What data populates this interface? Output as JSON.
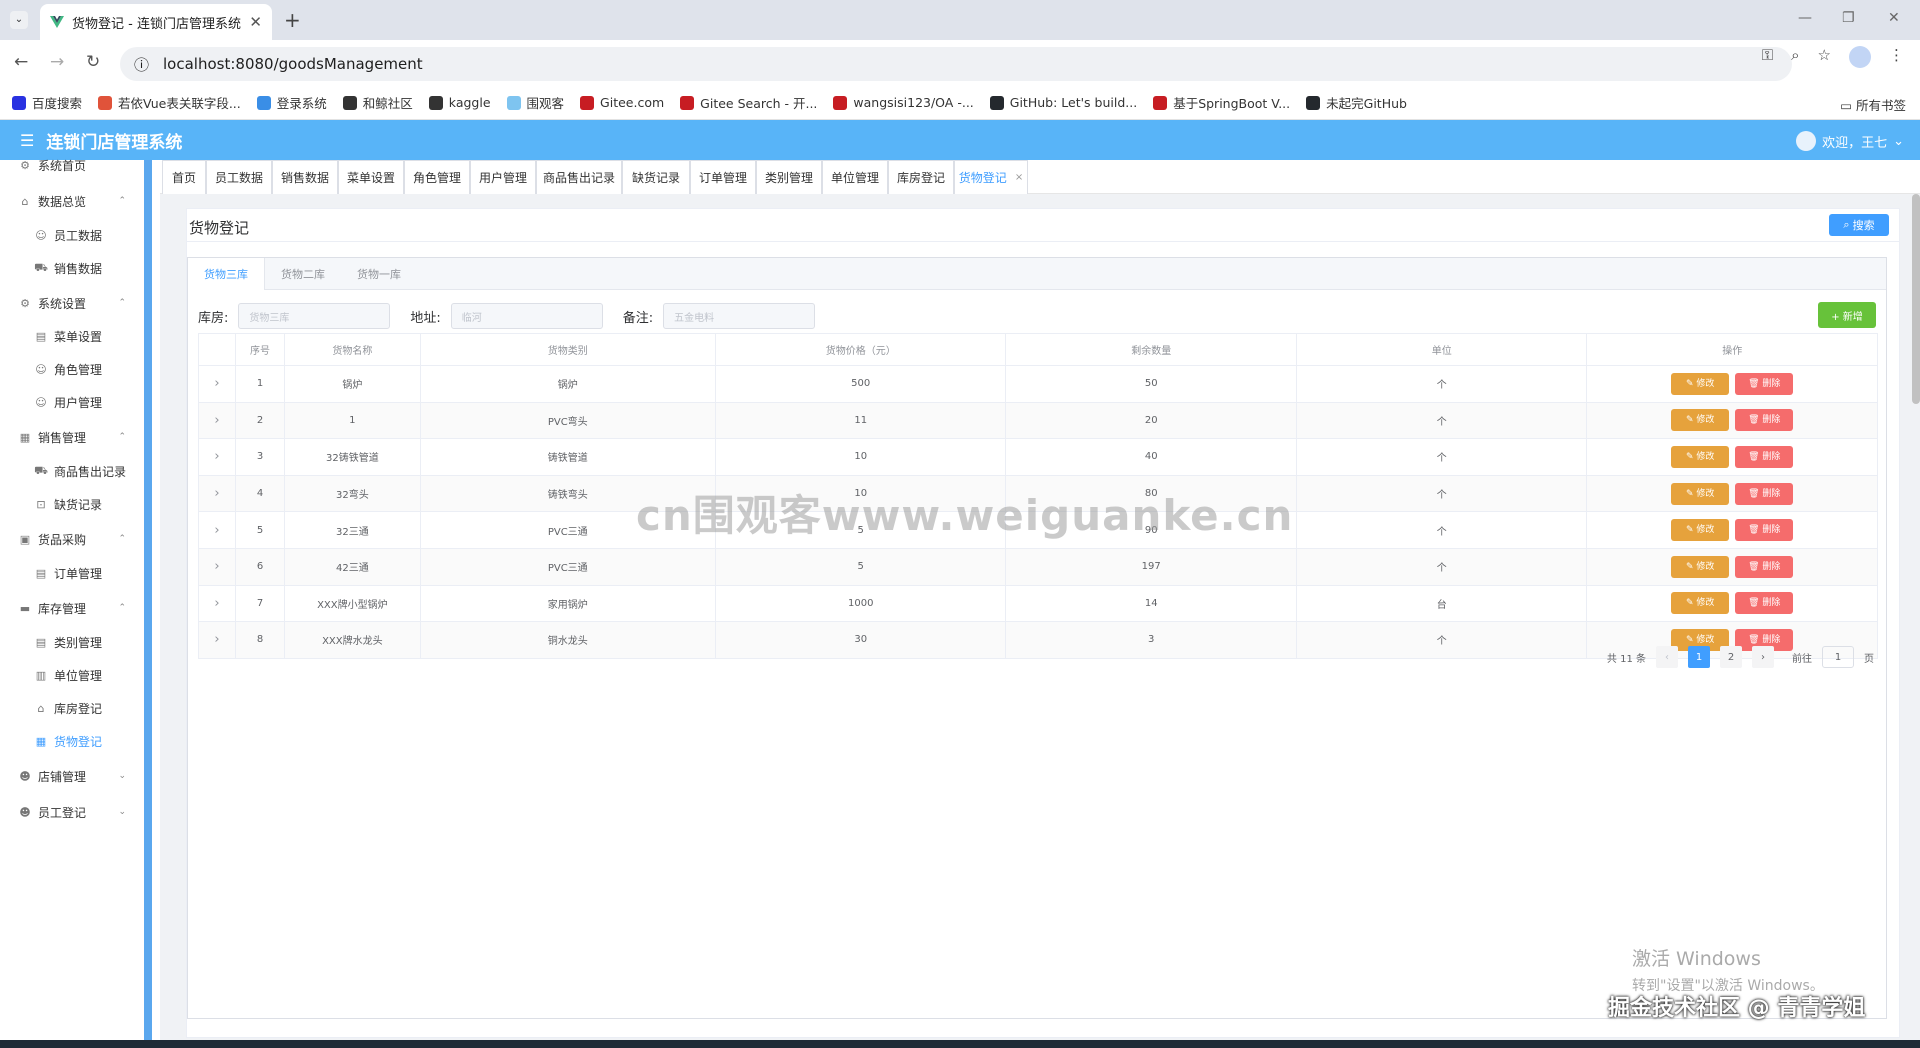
{
  "browser": {
    "tab_title": "货物登记 - 连锁门店管理系统",
    "tab_close": "✕",
    "new_tab": "+",
    "url": "localhost:8080/goodsManagement",
    "bookmarks": [
      {
        "label": "百度搜索",
        "color": "#2932e1"
      },
      {
        "label": "若依Vue表关联字段...",
        "color": "#e0533a"
      },
      {
        "label": "登录系统",
        "color": "#3a8ee6"
      },
      {
        "label": "和鲸社区",
        "color": "#333333"
      },
      {
        "label": "kaggle",
        "color": "#333333"
      },
      {
        "label": "围观客",
        "color": "#7ec4f0"
      },
      {
        "label": "Gitee.com",
        "color": "#c71d23"
      },
      {
        "label": "Gitee Search - 开...",
        "color": "#c71d23"
      },
      {
        "label": "wangsisi123/OA -...",
        "color": "#c71d23"
      },
      {
        "label": "GitHub: Let's build...",
        "color": "#24292e"
      },
      {
        "label": "基于SpringBoot V...",
        "color": "#c71d23"
      },
      {
        "label": "未起完GitHub",
        "color": "#24292e"
      }
    ],
    "all_bookmarks": "所有书签"
  },
  "app": {
    "title": "连锁门店管理系统",
    "user": "欢迎，王七",
    "accent": "#58b4f8"
  },
  "sidebar": [
    {
      "label": "系统首页",
      "level": 0,
      "icon": "gear-icon",
      "glyph": "⚙"
    },
    {
      "label": "数据总览",
      "level": 0,
      "icon": "home-icon",
      "glyph": "⌂",
      "chev": "⌃"
    },
    {
      "label": "员工数据",
      "level": 1,
      "icon": "user-icon",
      "glyph": "☺"
    },
    {
      "label": "销售数据",
      "level": 1,
      "icon": "truck-icon",
      "glyph": "⛟"
    },
    {
      "label": "系统设置",
      "level": 0,
      "icon": "settings-icon",
      "glyph": "⚙",
      "chev": "⌃"
    },
    {
      "label": "菜单设置",
      "level": 1,
      "icon": "document-icon",
      "glyph": "▤"
    },
    {
      "label": "角色管理",
      "level": 1,
      "icon": "user-icon",
      "glyph": "☺"
    },
    {
      "label": "用户管理",
      "level": 1,
      "icon": "user-icon",
      "glyph": "☺"
    },
    {
      "label": "销售管理",
      "level": 0,
      "icon": "list-icon",
      "glyph": "▦",
      "chev": "⌃"
    },
    {
      "label": "商品售出记录",
      "level": 1,
      "icon": "truck-icon",
      "glyph": "⛟"
    },
    {
      "label": "缺货记录",
      "level": 1,
      "icon": "box-icon",
      "glyph": "⊡"
    },
    {
      "label": "货品采购",
      "level": 0,
      "icon": "bag-icon",
      "glyph": "▣",
      "chev": "⌃"
    },
    {
      "label": "订单管理",
      "level": 1,
      "icon": "document-icon",
      "glyph": "▤"
    },
    {
      "label": "库存管理",
      "level": 0,
      "icon": "box-icon",
      "glyph": "▬",
      "chev": "⌃"
    },
    {
      "label": "类别管理",
      "level": 1,
      "icon": "document-icon",
      "glyph": "▤"
    },
    {
      "label": "单位管理",
      "level": 1,
      "icon": "grid-icon",
      "glyph": "▥"
    },
    {
      "label": "库房登记",
      "level": 1,
      "icon": "house-icon",
      "glyph": "⌂"
    },
    {
      "label": "货物登记",
      "level": 1,
      "icon": "calendar-icon",
      "glyph": "▦",
      "active": true
    },
    {
      "label": "店铺管理",
      "level": 0,
      "icon": "user-icon",
      "glyph": "☻",
      "chev": "⌄"
    },
    {
      "label": "员工登记",
      "level": 0,
      "icon": "user-icon",
      "glyph": "☻",
      "chev": "⌄"
    }
  ],
  "tags": [
    "首页",
    "员工数据",
    "销售数据",
    "菜单设置",
    "角色管理",
    "用户管理",
    "商品售出记录",
    "缺货记录",
    "订单管理",
    "类别管理",
    "单位管理",
    "库房登记",
    "货物登记"
  ],
  "active_tag": "货物登记",
  "tag_close": "×",
  "card": {
    "title": "货物登记",
    "search_label": "搜索",
    "tabs": [
      "货物三库",
      "货物二库",
      "货物一库"
    ],
    "filters": {
      "warehouse_label": "库房:",
      "warehouse_value": "货物三库",
      "address_label": "地址:",
      "address_value": "临河",
      "remark_label": "备注:",
      "remark_value": "五金电料"
    },
    "add_label": "+ 新增",
    "columns": [
      "",
      "序号",
      "货物名称",
      "货物类别",
      "货物价格（元）",
      "剩余数量",
      "单位",
      "操作"
    ],
    "rows": [
      {
        "no": "1",
        "name": "锅炉",
        "category": "锅炉",
        "price": "500",
        "qty": "50",
        "unit": "个"
      },
      {
        "no": "2",
        "name": "1",
        "category": "PVC弯头",
        "price": "11",
        "qty": "20",
        "unit": "个"
      },
      {
        "no": "3",
        "name": "32铸铁管道",
        "category": "铸铁管道",
        "price": "10",
        "qty": "40",
        "unit": "个"
      },
      {
        "no": "4",
        "name": "32弯头",
        "category": "铸铁弯头",
        "price": "10",
        "qty": "80",
        "unit": "个"
      },
      {
        "no": "5",
        "name": "32三通",
        "category": "PVC三通",
        "price": "5",
        "qty": "90",
        "unit": "个"
      },
      {
        "no": "6",
        "name": "42三通",
        "category": "PVC三通",
        "price": "5",
        "qty": "197",
        "unit": "个"
      },
      {
        "no": "7",
        "name": "XXX牌小型锅炉",
        "category": "家用锅炉",
        "price": "1000",
        "qty": "14",
        "unit": "台"
      },
      {
        "no": "8",
        "name": "XXX牌水龙头",
        "category": "铜水龙头",
        "price": "30",
        "qty": "3",
        "unit": "个"
      }
    ],
    "edit_label": "✎ 修改",
    "delete_label": "🗑 删除",
    "pagination": {
      "total": "共 11 条",
      "prev": "‹",
      "next": "›",
      "pages": [
        "1",
        "2"
      ],
      "current": "1",
      "goto_label": "前往",
      "goto_value": "1",
      "page_unit": "页"
    }
  },
  "overlay": {
    "watermark": "cn围观客www.weiguanke.cn",
    "windows_activate": "激活 Windows",
    "windows_activate_sub": "转到\"设置\"以激活 Windows。",
    "signature": "掘金技术社区 @ 青青学姐"
  }
}
